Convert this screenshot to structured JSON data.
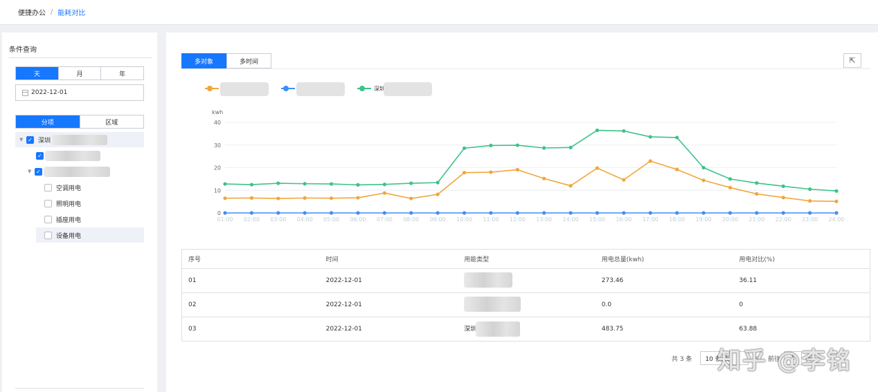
{
  "breadcrumb": {
    "parent": "便捷办公",
    "separator": "/",
    "current": "能耗对比"
  },
  "left": {
    "title": "条件查询",
    "time_options": [
      "天",
      "月",
      "年"
    ],
    "time_active": "天",
    "date_value": "2022-12-01",
    "type_options": [
      "分项",
      "区域"
    ],
    "type_active": "分项",
    "tree": {
      "root_label": "深圳",
      "children": [
        "空调用电",
        "照明用电",
        "插座用电",
        "设备用电"
      ]
    }
  },
  "main": {
    "tabs": [
      "多对象",
      "多时间"
    ],
    "tab_active": "多对象",
    "export_icon": "export-icon"
  },
  "chart_data": {
    "type": "line",
    "ylabel": "kwh",
    "ylim": [
      0,
      40
    ],
    "yticks": [
      0,
      10,
      20,
      30,
      40
    ],
    "categories": [
      "01:00",
      "02:00",
      "03:00",
      "04:00",
      "05:00",
      "06:00",
      "07:00",
      "08:00",
      "09:00",
      "10:00",
      "11:00",
      "12:00",
      "13:00",
      "14:00",
      "15:00",
      "16:00",
      "17:00",
      "18:00",
      "19:00",
      "20:00",
      "21:00",
      "22:00",
      "23:00",
      "24:00"
    ],
    "grid": true,
    "legend_position": "top-left",
    "series": [
      {
        "name": "",
        "color": "#f0a63a",
        "values": [
          6.5,
          6.6,
          6.4,
          6.6,
          6.5,
          6.7,
          8.8,
          6.4,
          8.2,
          17.8,
          18.0,
          19.1,
          15.2,
          12.0,
          19.8,
          14.6,
          22.9,
          19.2,
          14.4,
          11.2,
          8.4,
          6.8,
          5.3,
          5.1
        ]
      },
      {
        "name": "",
        "color": "#3f8ef5",
        "values": [
          0,
          0,
          0,
          0,
          0,
          0,
          0,
          0,
          0,
          0,
          0,
          0,
          0,
          0,
          0,
          0,
          0,
          0,
          0,
          0,
          0,
          0,
          0,
          0
        ]
      },
      {
        "name": "深圳",
        "color": "#3ec28a",
        "values": [
          12.8,
          12.5,
          13.1,
          12.9,
          12.8,
          12.4,
          12.6,
          13.1,
          13.4,
          28.6,
          29.8,
          29.9,
          28.7,
          28.9,
          36.5,
          36.2,
          33.6,
          33.3,
          20.0,
          15.0,
          13.2,
          11.8,
          10.5,
          9.7
        ]
      }
    ]
  },
  "table": {
    "headers": [
      "序号",
      "时间",
      "用能类型",
      "用电总量(kwh)",
      "用电对比(%)"
    ],
    "rows": [
      {
        "no": "01",
        "date": "2022-12-01",
        "type": "",
        "total": "273.46",
        "ratio": "36.11"
      },
      {
        "no": "02",
        "date": "2022-12-01",
        "type": "",
        "total": "0.0",
        "ratio": "0"
      },
      {
        "no": "03",
        "date": "2022-12-01",
        "type": "深圳",
        "total": "483.75",
        "ratio": "63.88"
      }
    ]
  },
  "pagination": {
    "total_text": "共 3 条",
    "page_size": "10 条/页",
    "prev": "<",
    "goto_prefix": "前往",
    "page": "1",
    "goto_suffix": "页"
  },
  "watermark": "知乎 @李铭"
}
